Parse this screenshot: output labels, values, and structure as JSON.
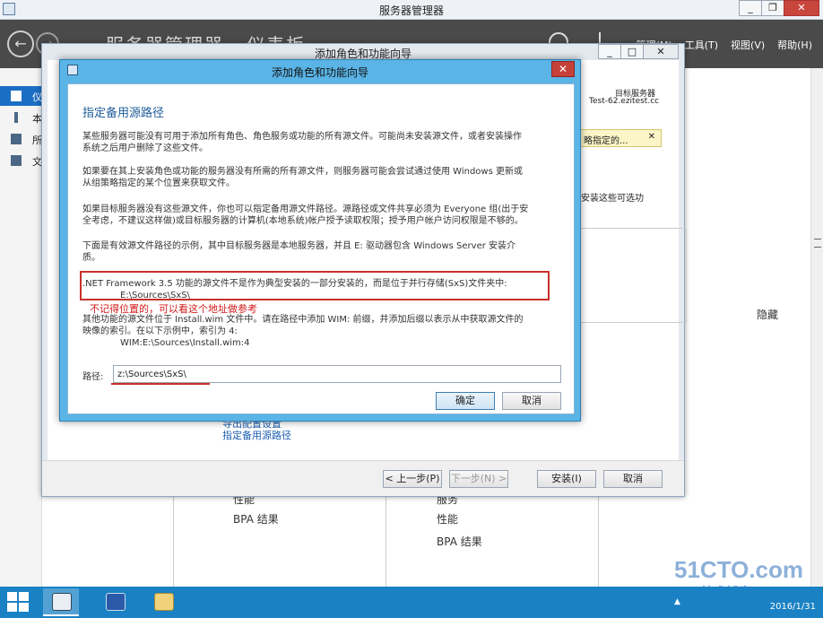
{
  "server_manager": {
    "title": "服务器管理器",
    "breadcrumb": "服务器管理器 · 仪表板",
    "menu": [
      "管理(M)",
      "工具(T)",
      "视图(V)",
      "帮助(H)"
    ],
    "sidebar": [
      {
        "label": "仪"
      },
      {
        "label": "本"
      },
      {
        "label": "所"
      },
      {
        "label": "文"
      }
    ],
    "tiles": {
      "left": [
        "性能",
        "BPA 结果"
      ],
      "right": [
        "服务",
        "性能",
        "BPA 结果"
      ]
    },
    "hide_label": "隐藏"
  },
  "wizard": {
    "title": "添加角色和功能向导",
    "target_label": "目标服务器",
    "target_server": "Test-62.ezitest.cc",
    "warning": "略指定的...",
    "side_text": "安装这些可选功",
    "links": [
      "导出配置设置",
      "指定备用源路径"
    ],
    "buttons": {
      "prev": "< 上一步(P)",
      "next": "下一步(N) >",
      "install": "安装(I)",
      "cancel": "取消"
    }
  },
  "dialog": {
    "title": "添加角色和功能向导",
    "heading": "指定备用源路径",
    "paragraphs": [
      "某些服务器可能没有可用于添加所有角色、角色服务或功能的所有源文件。可能尚未安装源文件，或者安装操作",
      "系统之后用户删除了这些文件。",
      "如果要在其上安装角色或功能的服务器没有所需的所有源文件，则服务器可能会尝试通过使用 Windows 更新或",
      "从组策略指定的某个位置来获取文件。",
      "如果目标服务器没有这些源文件，你也可以指定备用源文件路径。源路径或文件共享必须为 Everyone 组(出于安",
      "全考虑，不建议这样做)或目标服务器的计算机(本地系统)帐户授予读取权限；授予用户帐户访问权限是不够的。",
      "下面是有效源文件路径的示例，其中目标服务器是本地服务器，并且 E: 驱动器包含 Windows Server 安装介",
      "质。",
      ".NET Framework 3.5 功能的源文件不是作为典型安装的一部分安装的，而是位于并行存储(SxS)文件夹中:",
      "E:\\Sources\\SxS\\",
      "其他功能的源文件位于 Install.wim 文件中。请在路径中添加 WIM: 前缀，并添加后缀以表示从中获取源文件的",
      "映像的索引。在以下示例中，索引为 4:",
      "WIM:E:\\Sources\\Install.wim:4"
    ],
    "annotation": "不记得位置的，可以看这个地址做参考",
    "path_label": "路径:",
    "path_value": "z:\\Sources\\SxS\\",
    "ok": "确定",
    "cancel": "取消"
  },
  "taskbar": {
    "clock_time": "2016/1/31",
    "clock_date": "2016/1/31"
  },
  "watermark": {
    "line1": "51CTO.com",
    "line2": "技术博客"
  },
  "colors": {
    "accent": "#1c6ec4",
    "dialog_frame": "#5ab4e6",
    "taskbar": "#1a82c4",
    "annotation": "#d21a1a"
  }
}
